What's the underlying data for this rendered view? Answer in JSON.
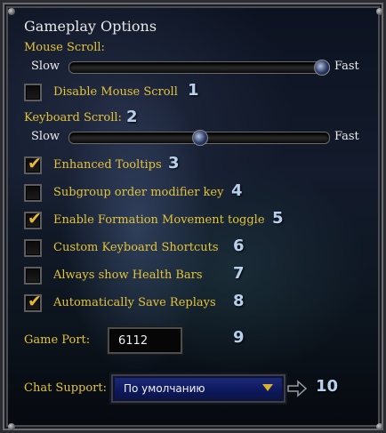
{
  "title": "Gameplay Options",
  "mouse_scroll": {
    "label": "Mouse Scroll:",
    "min_label": "Slow",
    "max_label": "Fast",
    "value": 0.97
  },
  "disable_mouse_scroll": {
    "label": "Disable Mouse Scroll",
    "checked": false,
    "number": "1"
  },
  "keyboard_scroll": {
    "label": "Keyboard Scroll:",
    "number": "2",
    "min_label": "Slow",
    "max_label": "Fast",
    "value": 0.5
  },
  "options": [
    {
      "label": "Enhanced Tooltips",
      "checked": true,
      "number": "3"
    },
    {
      "label": "Subgroup order modifier key",
      "checked": false,
      "number": "4"
    },
    {
      "label": "Enable Formation Movement toggle",
      "checked": true,
      "number": "5"
    },
    {
      "label": "Custom Keyboard Shortcuts",
      "checked": false,
      "number": "6"
    },
    {
      "label": "Always show Health Bars",
      "checked": false,
      "number": "7"
    },
    {
      "label": "Automatically Save Replays",
      "checked": true,
      "number": "8"
    }
  ],
  "game_port": {
    "label": "Game Port:",
    "value": "6112",
    "number": "9"
  },
  "chat_support": {
    "label": "Chat Support:",
    "selected": "По умолчанию",
    "number": "10"
  },
  "colors": {
    "gold": "#e3c33a",
    "annotation": "#b8d0ee",
    "select_bg": "#122070"
  }
}
